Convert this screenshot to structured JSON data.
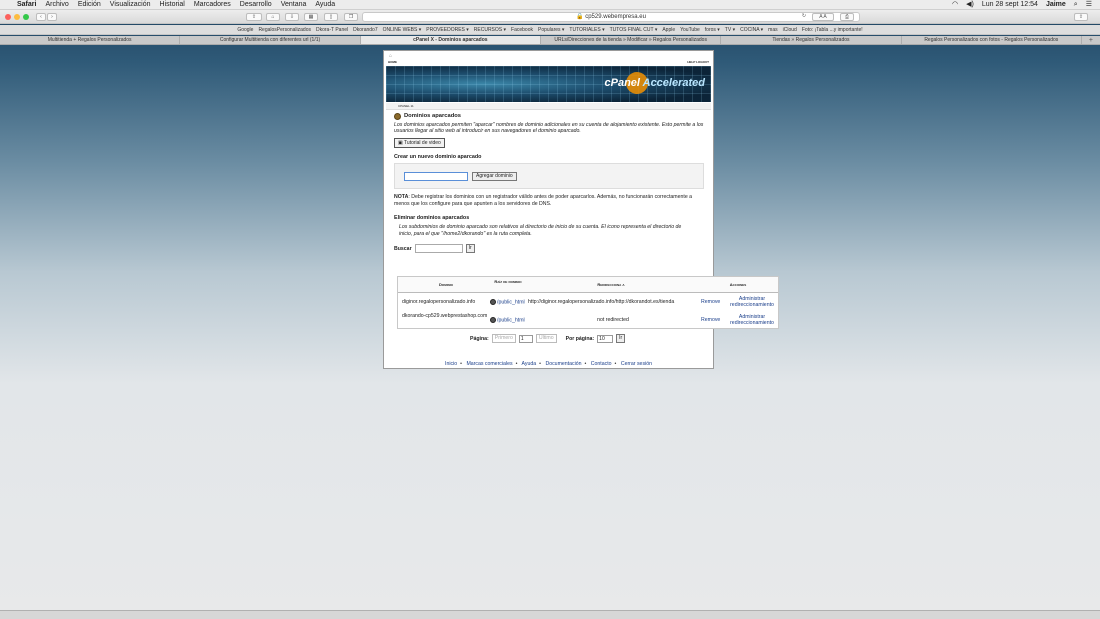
{
  "menubar": {
    "app": "Safari",
    "items": [
      "Archivo",
      "Edición",
      "Visualización",
      "Historial",
      "Marcadores",
      "Desarrollo",
      "Ventana",
      "Ayuda"
    ],
    "clock": "Lun 28 sept 12:54",
    "user": "Jaime"
  },
  "browser": {
    "url": "cp529.webempresa.eu",
    "reader": "A A",
    "bookmarks": [
      "Google",
      "RegalosPersonalizados",
      "Dkora-T Panel",
      "Dkorando7",
      "ONLINE WEBS ▾",
      "PROVEEDORES ▾",
      "RECURSOS ▾",
      "Facebook",
      "Populares ▾",
      "TUTORIALES ▾",
      "TUTOS FINAL CUT ▾",
      "Apple",
      "YouTube",
      "foros ▾",
      "TV ▾",
      "COCINA ▾",
      "mas",
      "iCloud",
      "Foto: ¡Tabla ...y importante!"
    ],
    "tabs": [
      {
        "label": "Multitienda + Regalos Personalizados",
        "active": false
      },
      {
        "label": "Configurar Multitienda con diferentes url (1/1)",
        "active": false
      },
      {
        "label": "cPanel X - Dominios aparcados",
        "active": true
      },
      {
        "label": "URLs/Direcciones de la tienda » Modificar » Regalos Personalizados",
        "active": false
      },
      {
        "label": "Tiendas » Regalos Personalizados",
        "active": false
      },
      {
        "label": "Regalos Personalizados con fotos - Regalos Personalizados",
        "active": false
      }
    ]
  },
  "cpanel": {
    "head_left": "HOME",
    "head_right": "HELP  LOGOUT",
    "brand_prefix": "cPanel",
    "brand_suffix": "Accelerated",
    "breadcrumb": "CPANEL 11",
    "title": "Dominios aparcados",
    "intro": "Los dominios aparcados permiten \"aparcar\" nombres de dominio adicionales en su cuenta de alojamiento existente. Esto permite a los usuarios llegar al sitio web al introducir en sus navegadores el dominio aparcado.",
    "video_button": "Tutorial de video",
    "create_heading": "Crear un nuevo dominio aparcado",
    "add_button": "Agregar dominio",
    "note_label": "NOTA",
    "note_text": ": Debe registrar los dominios con un registrador válido antes de poder aparcarlos. Además, no funcionarán correctamente a menos que los configure para que apunten a los servidores de DNS.",
    "remove_heading": "Eliminar dominios aparcados",
    "remove_text": "Los subdominios de dominio aparcado son relativos al directorio de inicio de su cuenta. El icono representa el directorio de inicio, para el que \"/home2/dkorando\" es la ruta completa.",
    "search_label": "Buscar",
    "go_button": "Ir",
    "table": {
      "headers": [
        "Dominio",
        "Raíz de dominio",
        "Redirecciona a",
        "Acciones"
      ],
      "rows": [
        {
          "domain": "diginor.regalopersonalizado.info",
          "root": "/public_html",
          "redirect": "http://diginor.regalopersonalizado.info/http://dkorandot.es/tienda",
          "remove": "Remove",
          "manage": "Administrar redireccionamiento"
        },
        {
          "domain": "dkorando-cp529.webprestashop.com",
          "root": "/public_html",
          "redirect": "not redirected",
          "remove": "Remove",
          "manage": "Administrar redireccionamiento"
        }
      ]
    },
    "pager": {
      "page_label": "Página:",
      "first": "Primero",
      "page_value": "1",
      "last": "Último",
      "per_page_label": "Por página:",
      "per_page_value": "10",
      "go": "Ir"
    },
    "footer": [
      "Inicio",
      "Marcas comerciales",
      "Ayuda",
      "Documentación",
      "Contacto",
      "Cerrar sesión"
    ]
  }
}
